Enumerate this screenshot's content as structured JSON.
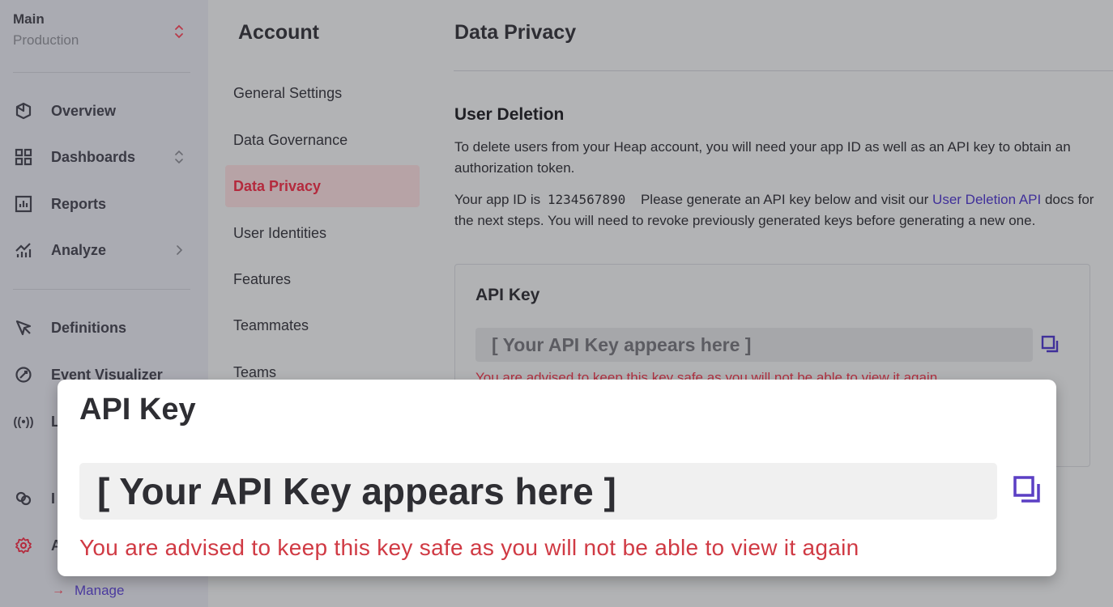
{
  "environment": {
    "main": "Main",
    "sub": "Production"
  },
  "nav": {
    "items": [
      {
        "label": "Overview",
        "icon": "overview-icon"
      },
      {
        "label": "Dashboards",
        "icon": "dashboards-icon",
        "chevron": "expand"
      },
      {
        "label": "Reports",
        "icon": "reports-icon"
      },
      {
        "label": "Analyze",
        "icon": "analyze-icon",
        "chevron": "right"
      },
      {
        "label": "Definitions",
        "icon": "definitions-icon"
      },
      {
        "label": "Event Visualizer",
        "icon": "event-visualizer-icon"
      },
      {
        "label": "L",
        "icon": "live-icon"
      },
      {
        "label": "I",
        "icon": "integrations-icon"
      },
      {
        "label": "A",
        "icon": "settings-icon"
      }
    ],
    "manage_label": "Manage"
  },
  "subnav": {
    "title": "Account",
    "items": [
      "General Settings",
      "Data Governance",
      "Data Privacy",
      "User Identities",
      "Features",
      "Teammates",
      "Teams"
    ],
    "active": "Data Privacy"
  },
  "main": {
    "title": "Data Privacy",
    "section_title": "User Deletion",
    "para1": "To delete users from your Heap account, you will need your app ID as well as an API key to obtain an authorization token.",
    "para2_prefix": "Your app ID is",
    "app_id": "1234567890",
    "para2_mid": "Please generate an API key below and visit our",
    "link_text": "User Deletion API",
    "para2_suffix": "docs for the next steps. You will need to revoke previously generated keys before generating a new one.",
    "api_card": {
      "title": "API Key",
      "placeholder": "[ Your API Key appears here ]",
      "warning": "You are advised to keep this key safe as you will not be able to view it again"
    }
  },
  "callout": {
    "title": "API Key",
    "placeholder": "[ Your API Key appears here ]",
    "warning": "You are advised to keep this key safe as you will not be able to view it again"
  },
  "colors": {
    "accent_purple": "#5b3fc4",
    "warning_red": "#d03a44",
    "active_red": "#b42a3d"
  }
}
